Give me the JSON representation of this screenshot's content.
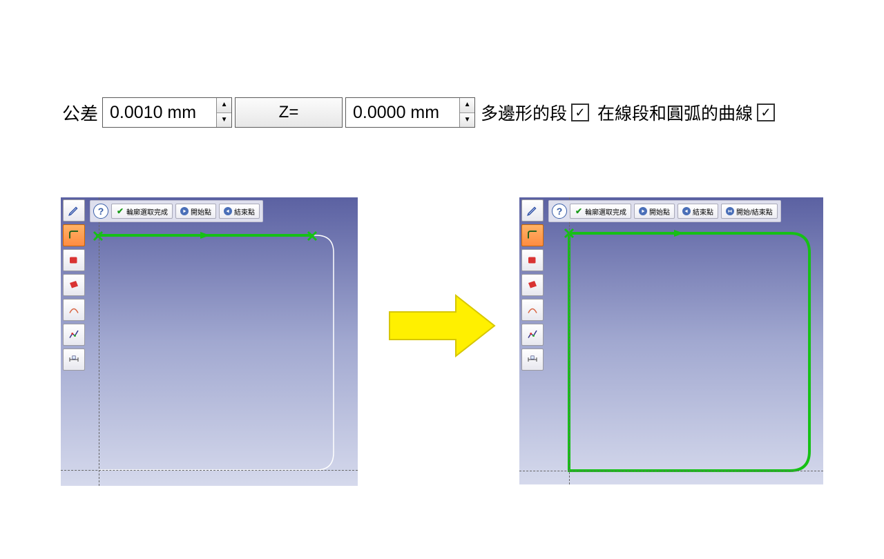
{
  "params": {
    "tolerance_label": "公差",
    "tolerance_value": "0.0010 mm",
    "z_button_label": "Z=",
    "z_value": "0.0000 mm",
    "check1_label": "多邊形的段",
    "check1_checked": true,
    "check2_label": "在線段和圓弧的曲線",
    "check2_checked": true
  },
  "popup_left": {
    "help": "?",
    "btn1": "輪廓選取完成",
    "btn2": "開始點",
    "btn3": "結束點"
  },
  "popup_right": {
    "help": "?",
    "btn1": "輪廓選取完成",
    "btn2": "開始點",
    "btn3": "結束點",
    "btn4": "開始/結束點"
  },
  "tool_icons": {
    "t1": "pen-icon",
    "t2": "profile-icon",
    "t3": "red-box-icon",
    "t4": "red-sheet-icon",
    "t5": "curve-icon",
    "t6": "graph-icon",
    "t7": "dimension-icon"
  }
}
